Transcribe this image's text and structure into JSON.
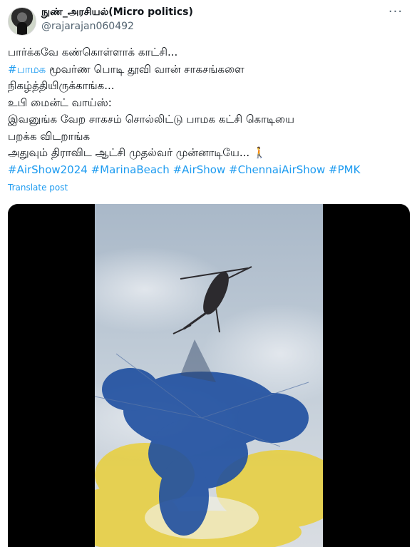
{
  "author": {
    "display_name": "நுண்_அரசியல்(Micro politics)",
    "handle": "@rajarajan060492"
  },
  "more_icon": "more-horizontal-icon",
  "tweet": {
    "line1": "பார்க்கவே கண்கொள்ளாக் காட்சி...",
    "line2_hashtag": "#பாமக",
    "line2_text": " மூவர்ண பொடி தூவி வான் சாகசங்களை",
    "line3": "நிகழ்த்தியிருக்காங்க...",
    "line4": "உபி மைன்ட் வாய்ஸ்:",
    "line5": "இவனுங்க வேற சாகசம் சொல்லிட்டு பாமக கட்சி கொடியை",
    "line6": "பறக்க விடறாங்க",
    "line7": "அதுவும் திராவிட ஆட்சி முதல்வர் முன்னாடியே... 🚶",
    "hashtags": [
      "#AirShow2024",
      "#MarinaBeach",
      "#AirShow",
      "#ChennaiAirShow",
      "#PMK"
    ]
  },
  "translate_label": "Translate post",
  "media": {
    "type": "video",
    "icon": "video-thumbnail",
    "colors": {
      "sky": "#b9c6d3",
      "blue_smoke": "#1f4fa0",
      "yellow_smoke": "#e9cf3a",
      "helicopter": "#2c2a2e"
    }
  },
  "colors": {
    "link": "#1d9bf0",
    "secondary": "#536471",
    "text": "#0f1419"
  }
}
